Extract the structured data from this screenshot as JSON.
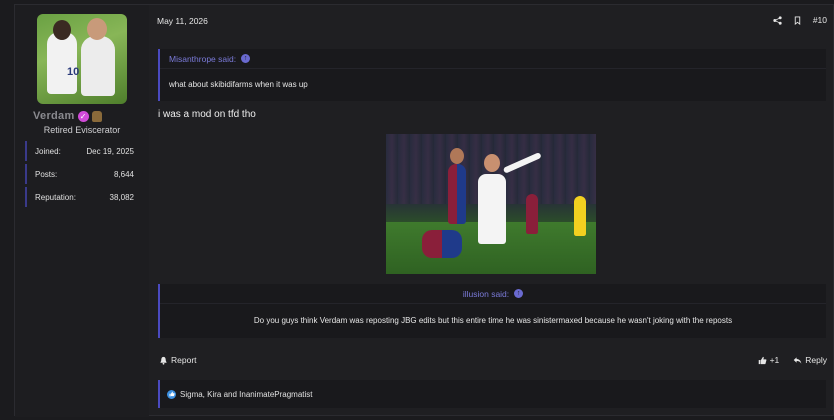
{
  "user": {
    "name": "Verdam",
    "title": "Retired Eviscerator",
    "stats": [
      {
        "label": "Joined:",
        "value": "Dec 19, 2025"
      },
      {
        "label": "Posts:",
        "value": "8,644"
      },
      {
        "label": "Reputation:",
        "value": "38,082"
      }
    ]
  },
  "post": {
    "date": "May 11, 2026",
    "number": "#10",
    "quote1": {
      "author": "Misanthrope said:",
      "text": "what about skibidifarms when it was up"
    },
    "message": "i was a mod on tfd tho",
    "quote2": {
      "author": "illusion said:",
      "text": "Do you guys think Verdam was reposting JBG edits but this entire time he was sinistermaxed because he wasn't joking with the reposts"
    },
    "report_label": "Report",
    "like_label": "+1",
    "reply_label": "Reply",
    "reactions_text": "Sigma, Kira and InanimatePragmatist"
  },
  "colors": {
    "accent": "#4a4ac0",
    "quote_author": "#7a7ad8",
    "verified_badge": "#d14bd8",
    "like_icon": "#3b8fe0"
  }
}
